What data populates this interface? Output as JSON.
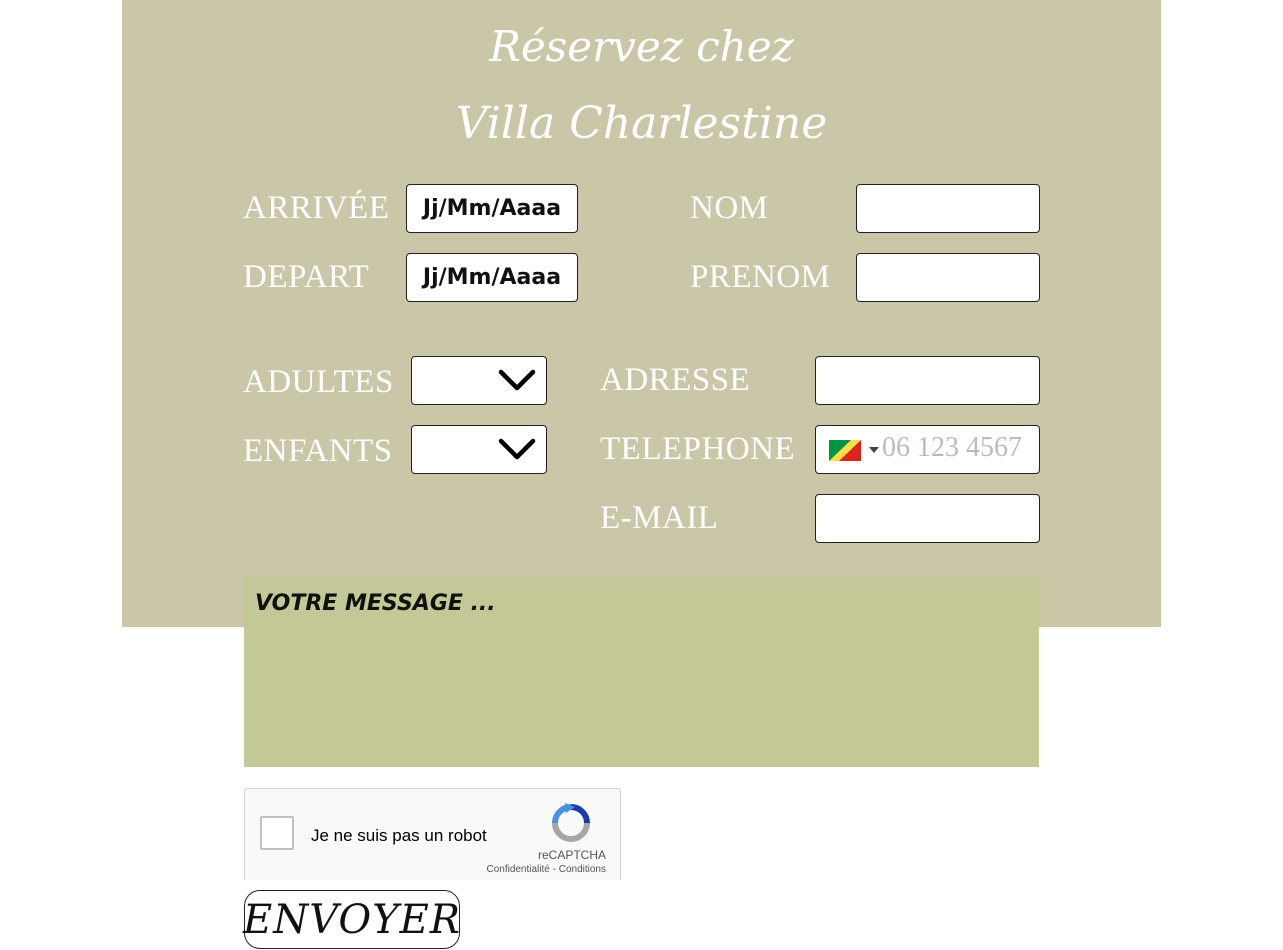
{
  "header": {
    "title_line1": "Réservez chez",
    "title_line2": "Villa Charlestine"
  },
  "form": {
    "arrivee_label": "ARRIVÉE",
    "arrivee_value": "Jj/Mm/Aaaa",
    "depart_label": "DEPART",
    "depart_value": "Jj/Mm/Aaaa",
    "nom_label": "NOM",
    "nom_value": "",
    "prenom_label": "PRENOM",
    "prenom_value": "",
    "adultes_label": "ADULTES",
    "adultes_value": "",
    "enfants_label": "ENFANTS",
    "enfants_value": "",
    "adresse_label": "ADRESSE",
    "adresse_value": "",
    "telephone_label": "TELEPHONE",
    "telephone_placeholder": "06 123 4567",
    "telephone_country_icon": "congo-flag-icon",
    "email_label": "E-MAIL",
    "email_value": "",
    "message_placeholder": "VOTRE MESSAGE ..."
  },
  "captcha": {
    "label": "Je ne suis pas un robot",
    "brand": "reCAPTCHA",
    "privacy": "Confidentialité",
    "separator": " - ",
    "terms": "Conditions"
  },
  "submit": {
    "label": "ENVOYER"
  },
  "colors": {
    "panel": "#c9c7a8",
    "message_bg": "#c3c896",
    "label_text": "#ffffff"
  }
}
